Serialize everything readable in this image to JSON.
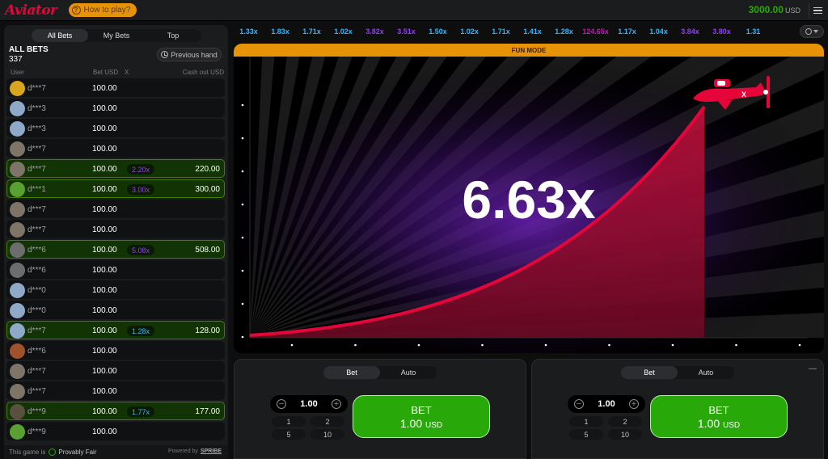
{
  "header": {
    "logo": "Aviator",
    "how_to_play": "How to play?",
    "balance": "3000.00",
    "currency": "USD"
  },
  "bets_panel": {
    "tabs": [
      "All Bets",
      "My Bets",
      "Top"
    ],
    "title": "ALL BETS",
    "count": "337",
    "previous_hand": "Previous hand",
    "columns": {
      "user": "User",
      "bet": "Bet USD",
      "x": "X",
      "cashout": "Cash out USD"
    },
    "rows": [
      {
        "user": "d***7",
        "bet": "100.00",
        "mult": "",
        "cashout": "",
        "win": false,
        "mult_color": "",
        "avatar": "#d9a521"
      },
      {
        "user": "d***3",
        "bet": "100.00",
        "mult": "",
        "cashout": "",
        "win": false,
        "mult_color": "",
        "avatar": "#8fa9c9"
      },
      {
        "user": "d***3",
        "bet": "100.00",
        "mult": "",
        "cashout": "",
        "win": false,
        "mult_color": "",
        "avatar": "#8fa9c9"
      },
      {
        "user": "d***7",
        "bet": "100.00",
        "mult": "",
        "cashout": "",
        "win": false,
        "mult_color": "",
        "avatar": "#7e7468"
      },
      {
        "user": "d***7",
        "bet": "100.00",
        "mult": "2.20x",
        "cashout": "220.00",
        "win": true,
        "mult_color": "#913ef8",
        "avatar": "#7e7468"
      },
      {
        "user": "d***1",
        "bet": "100.00",
        "mult": "3.00x",
        "cashout": "300.00",
        "win": true,
        "mult_color": "#913ef8",
        "avatar": "#5aa033"
      },
      {
        "user": "d***7",
        "bet": "100.00",
        "mult": "",
        "cashout": "",
        "win": false,
        "mult_color": "",
        "avatar": "#7e7468"
      },
      {
        "user": "d***7",
        "bet": "100.00",
        "mult": "",
        "cashout": "",
        "win": false,
        "mult_color": "",
        "avatar": "#7e7468"
      },
      {
        "user": "d***6",
        "bet": "100.00",
        "mult": "5.08x",
        "cashout": "508.00",
        "win": true,
        "mult_color": "#913ef8",
        "avatar": "#6d6d6d"
      },
      {
        "user": "d***6",
        "bet": "100.00",
        "mult": "",
        "cashout": "",
        "win": false,
        "mult_color": "",
        "avatar": "#6d6d6d"
      },
      {
        "user": "d***0",
        "bet": "100.00",
        "mult": "",
        "cashout": "",
        "win": false,
        "mult_color": "",
        "avatar": "#8fa9c9"
      },
      {
        "user": "d***0",
        "bet": "100.00",
        "mult": "",
        "cashout": "",
        "win": false,
        "mult_color": "",
        "avatar": "#8fa9c9"
      },
      {
        "user": "d***7",
        "bet": "100.00",
        "mult": "1.28x",
        "cashout": "128.00",
        "win": true,
        "mult_color": "#34b4ff",
        "avatar": "#8fa9c9"
      },
      {
        "user": "d***6",
        "bet": "100.00",
        "mult": "",
        "cashout": "",
        "win": false,
        "mult_color": "",
        "avatar": "#a0522d"
      },
      {
        "user": "d***7",
        "bet": "100.00",
        "mult": "",
        "cashout": "",
        "win": false,
        "mult_color": "",
        "avatar": "#7e7468"
      },
      {
        "user": "d***7",
        "bet": "100.00",
        "mult": "",
        "cashout": "",
        "win": false,
        "mult_color": "",
        "avatar": "#7e7468"
      },
      {
        "user": "d***9",
        "bet": "100.00",
        "mult": "1.77x",
        "cashout": "177.00",
        "win": true,
        "mult_color": "#34b4ff",
        "avatar": "#5a5040"
      },
      {
        "user": "d***9",
        "bet": "100.00",
        "mult": "",
        "cashout": "",
        "win": false,
        "mult_color": "",
        "avatar": "#5aa033"
      }
    ],
    "footer": {
      "prefix": "This game is",
      "provably_fair": "Provably Fair",
      "powered_by": "Powered by",
      "brand": "SPRIBE"
    }
  },
  "history": [
    {
      "v": "1.33x",
      "c": "#34b4ff"
    },
    {
      "v": "1.83x",
      "c": "#34b4ff"
    },
    {
      "v": "1.71x",
      "c": "#34b4ff"
    },
    {
      "v": "1.02x",
      "c": "#34b4ff"
    },
    {
      "v": "3.82x",
      "c": "#913ef8"
    },
    {
      "v": "3.51x",
      "c": "#913ef8"
    },
    {
      "v": "1.50x",
      "c": "#34b4ff"
    },
    {
      "v": "1.02x",
      "c": "#34b4ff"
    },
    {
      "v": "1.71x",
      "c": "#34b4ff"
    },
    {
      "v": "1.41x",
      "c": "#34b4ff"
    },
    {
      "v": "1.28x",
      "c": "#34b4ff"
    },
    {
      "v": "124.65x",
      "c": "#c017b4"
    },
    {
      "v": "1.17x",
      "c": "#34b4ff"
    },
    {
      "v": "1.04x",
      "c": "#34b4ff"
    },
    {
      "v": "3.84x",
      "c": "#913ef8"
    },
    {
      "v": "3.80x",
      "c": "#913ef8"
    },
    {
      "v": "1.31",
      "c": "#34b4ff"
    }
  ],
  "game": {
    "banner": "FUN MODE",
    "multiplier": "6.63x",
    "curve_color": "#e50539",
    "icons": {
      "plane": "plane-icon",
      "history": "history-icon"
    }
  },
  "bet_panels": [
    {
      "tabs": [
        "Bet",
        "Auto"
      ],
      "stake": "1.00",
      "quick": [
        "1",
        "2",
        "5",
        "10"
      ],
      "btn_label": "BET",
      "btn_amount": "1.00",
      "btn_currency": "USD",
      "dash": ""
    },
    {
      "tabs": [
        "Bet",
        "Auto"
      ],
      "stake": "1.00",
      "quick": [
        "1",
        "2",
        "5",
        "10"
      ],
      "btn_label": "BET",
      "btn_amount": "1.00",
      "btn_currency": "USD",
      "dash": "—"
    }
  ]
}
